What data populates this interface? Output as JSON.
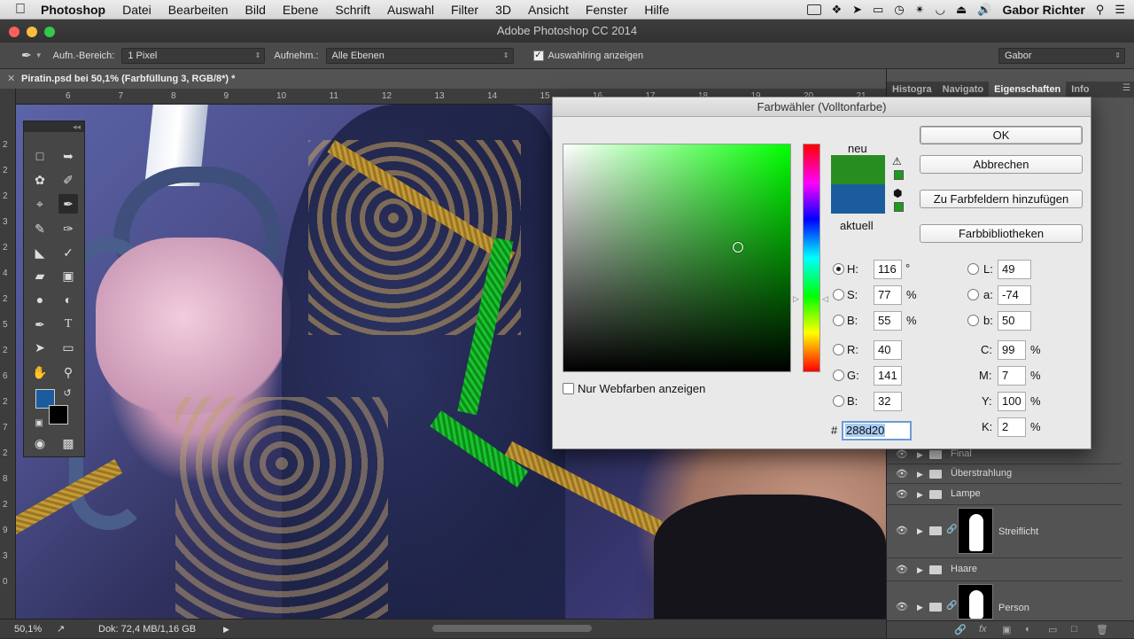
{
  "menubar": {
    "apple": "",
    "items": [
      "Photoshop",
      "Datei",
      "Bearbeiten",
      "Bild",
      "Ebene",
      "Schrift",
      "Auswahl",
      "Filter",
      "3D",
      "Ansicht",
      "Fenster",
      "Hilfe"
    ],
    "user": "Gabor Richter"
  },
  "window": {
    "title": "Adobe Photoshop CC 2014"
  },
  "options": {
    "sample_size_label": "Aufn.-Bereich:",
    "sample_size_value": "1 Pixel",
    "sample_label": "Aufnehm.:",
    "sample_value": "Alle Ebenen",
    "show_ring_label": "Auswahlring anzeigen",
    "workspace": "Gabor"
  },
  "document": {
    "tab_title": "Piratin.psd bei 50,1% (Farbfüllung 3, RGB/8*) *",
    "ruler_top": [
      "6",
      "7",
      "8",
      "9",
      "10",
      "11",
      "12",
      "13",
      "14",
      "15",
      "16",
      "17",
      "18",
      "19",
      "20",
      "21"
    ],
    "ruler_left": [
      "2",
      "2",
      "2",
      "3",
      "2",
      "4",
      "2",
      "5",
      "2",
      "6",
      "2",
      "7",
      "2",
      "8",
      "2",
      "9",
      "3",
      "0"
    ]
  },
  "status": {
    "zoom": "50,1%",
    "doc": "Dok: 72,4 MB/1,16 GB"
  },
  "panels": {
    "tabs": [
      "Histogra",
      "Navigato",
      "Eigenschaften",
      "Info"
    ],
    "layers": [
      {
        "name": "Final"
      },
      {
        "name": "Überstrahlung"
      },
      {
        "name": "Lampe"
      },
      {
        "name": "Streiflicht"
      },
      {
        "name": "Haare"
      },
      {
        "name": "Person"
      }
    ],
    "fx": "fx"
  },
  "picker": {
    "title": "Farbwähler (Volltonfarbe)",
    "new_label": "neu",
    "current_label": "aktuell",
    "new_color": "#288d20",
    "current_color": "#1b5c9e",
    "buttons": {
      "ok": "OK",
      "cancel": "Abbrechen",
      "add_swatch": "Zu Farbfeldern hinzufügen",
      "libraries": "Farbbibliotheken"
    },
    "web_only_label": "Nur Webfarben anzeigen",
    "hsb": {
      "H": "116",
      "S": "77",
      "B": "55"
    },
    "rgb": {
      "R": "40",
      "G": "141",
      "B": "32"
    },
    "lab": {
      "L": "49",
      "a": "-74",
      "b": "50"
    },
    "cmyk": {
      "C": "99",
      "M": "7",
      "Y": "100",
      "K": "2"
    },
    "hex": "288d20",
    "labels": {
      "H": "H:",
      "S": "S:",
      "Bv": "B:",
      "R": "R:",
      "G": "G:",
      "Bb": "B:",
      "L": "L:",
      "a": "a:",
      "b": "b:",
      "C": "C:",
      "M": "M:",
      "Y": "Y:",
      "K": "K:",
      "hash": "#",
      "deg": "°",
      "pct": "%"
    }
  }
}
